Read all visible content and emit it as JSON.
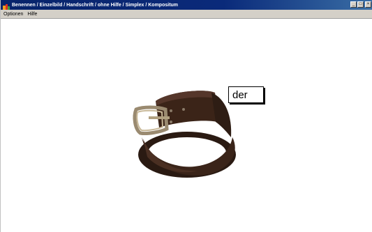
{
  "window": {
    "title": "Benennen / Einzelbild / Handschrift / ohne Hilfe / Simplex / Kompositum",
    "controls": {
      "minimize": "_",
      "maximize": "□",
      "close": "×"
    }
  },
  "menu": {
    "items": [
      {
        "label": "Optionen"
      },
      {
        "label": "Hilfe"
      }
    ]
  },
  "content": {
    "article": "der",
    "image": "belt-image"
  },
  "colors": {
    "titlebar": "#08246b",
    "background": "#ffffff",
    "menubar": "#d4d0c8"
  }
}
